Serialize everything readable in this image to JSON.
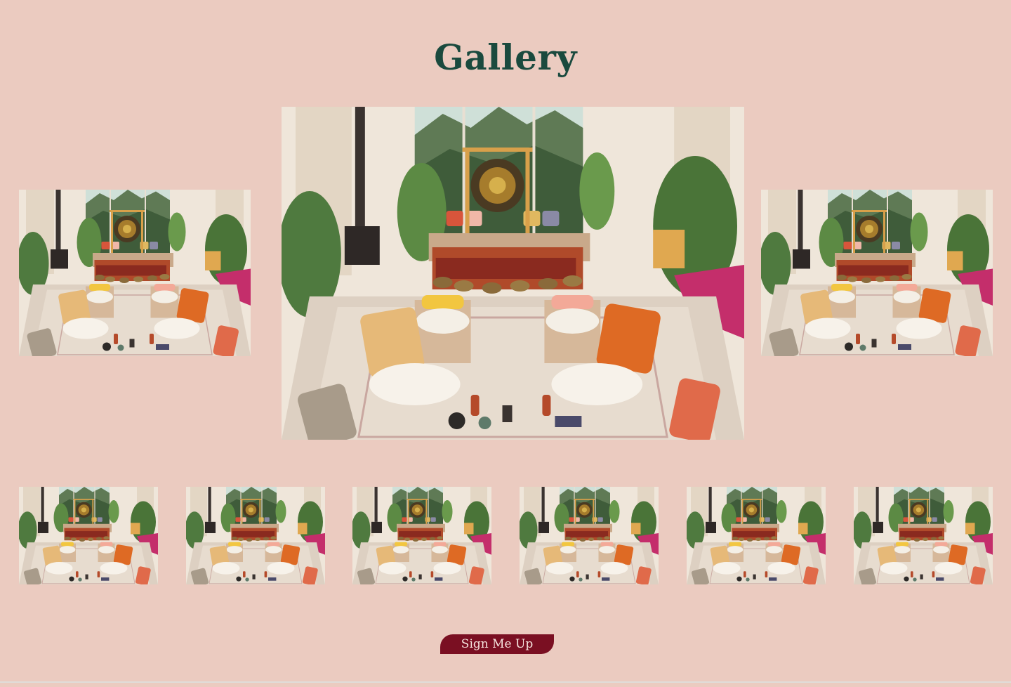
{
  "page": {
    "title": "Gallery",
    "background": "#ebcbc0",
    "title_color": "#1a4a3e"
  },
  "gallery": {
    "main_image": "sound-bath-room-photo",
    "side_images": [
      "sound-bath-room-photo",
      "sound-bath-room-photo"
    ],
    "thumbnails": [
      "sound-bath-room-photo",
      "sound-bath-room-photo",
      "sound-bath-room-photo",
      "sound-bath-room-photo",
      "sound-bath-room-photo",
      "sound-bath-room-photo"
    ]
  },
  "cta": {
    "label": "Sign Me Up",
    "color": "#7a0f22"
  }
}
